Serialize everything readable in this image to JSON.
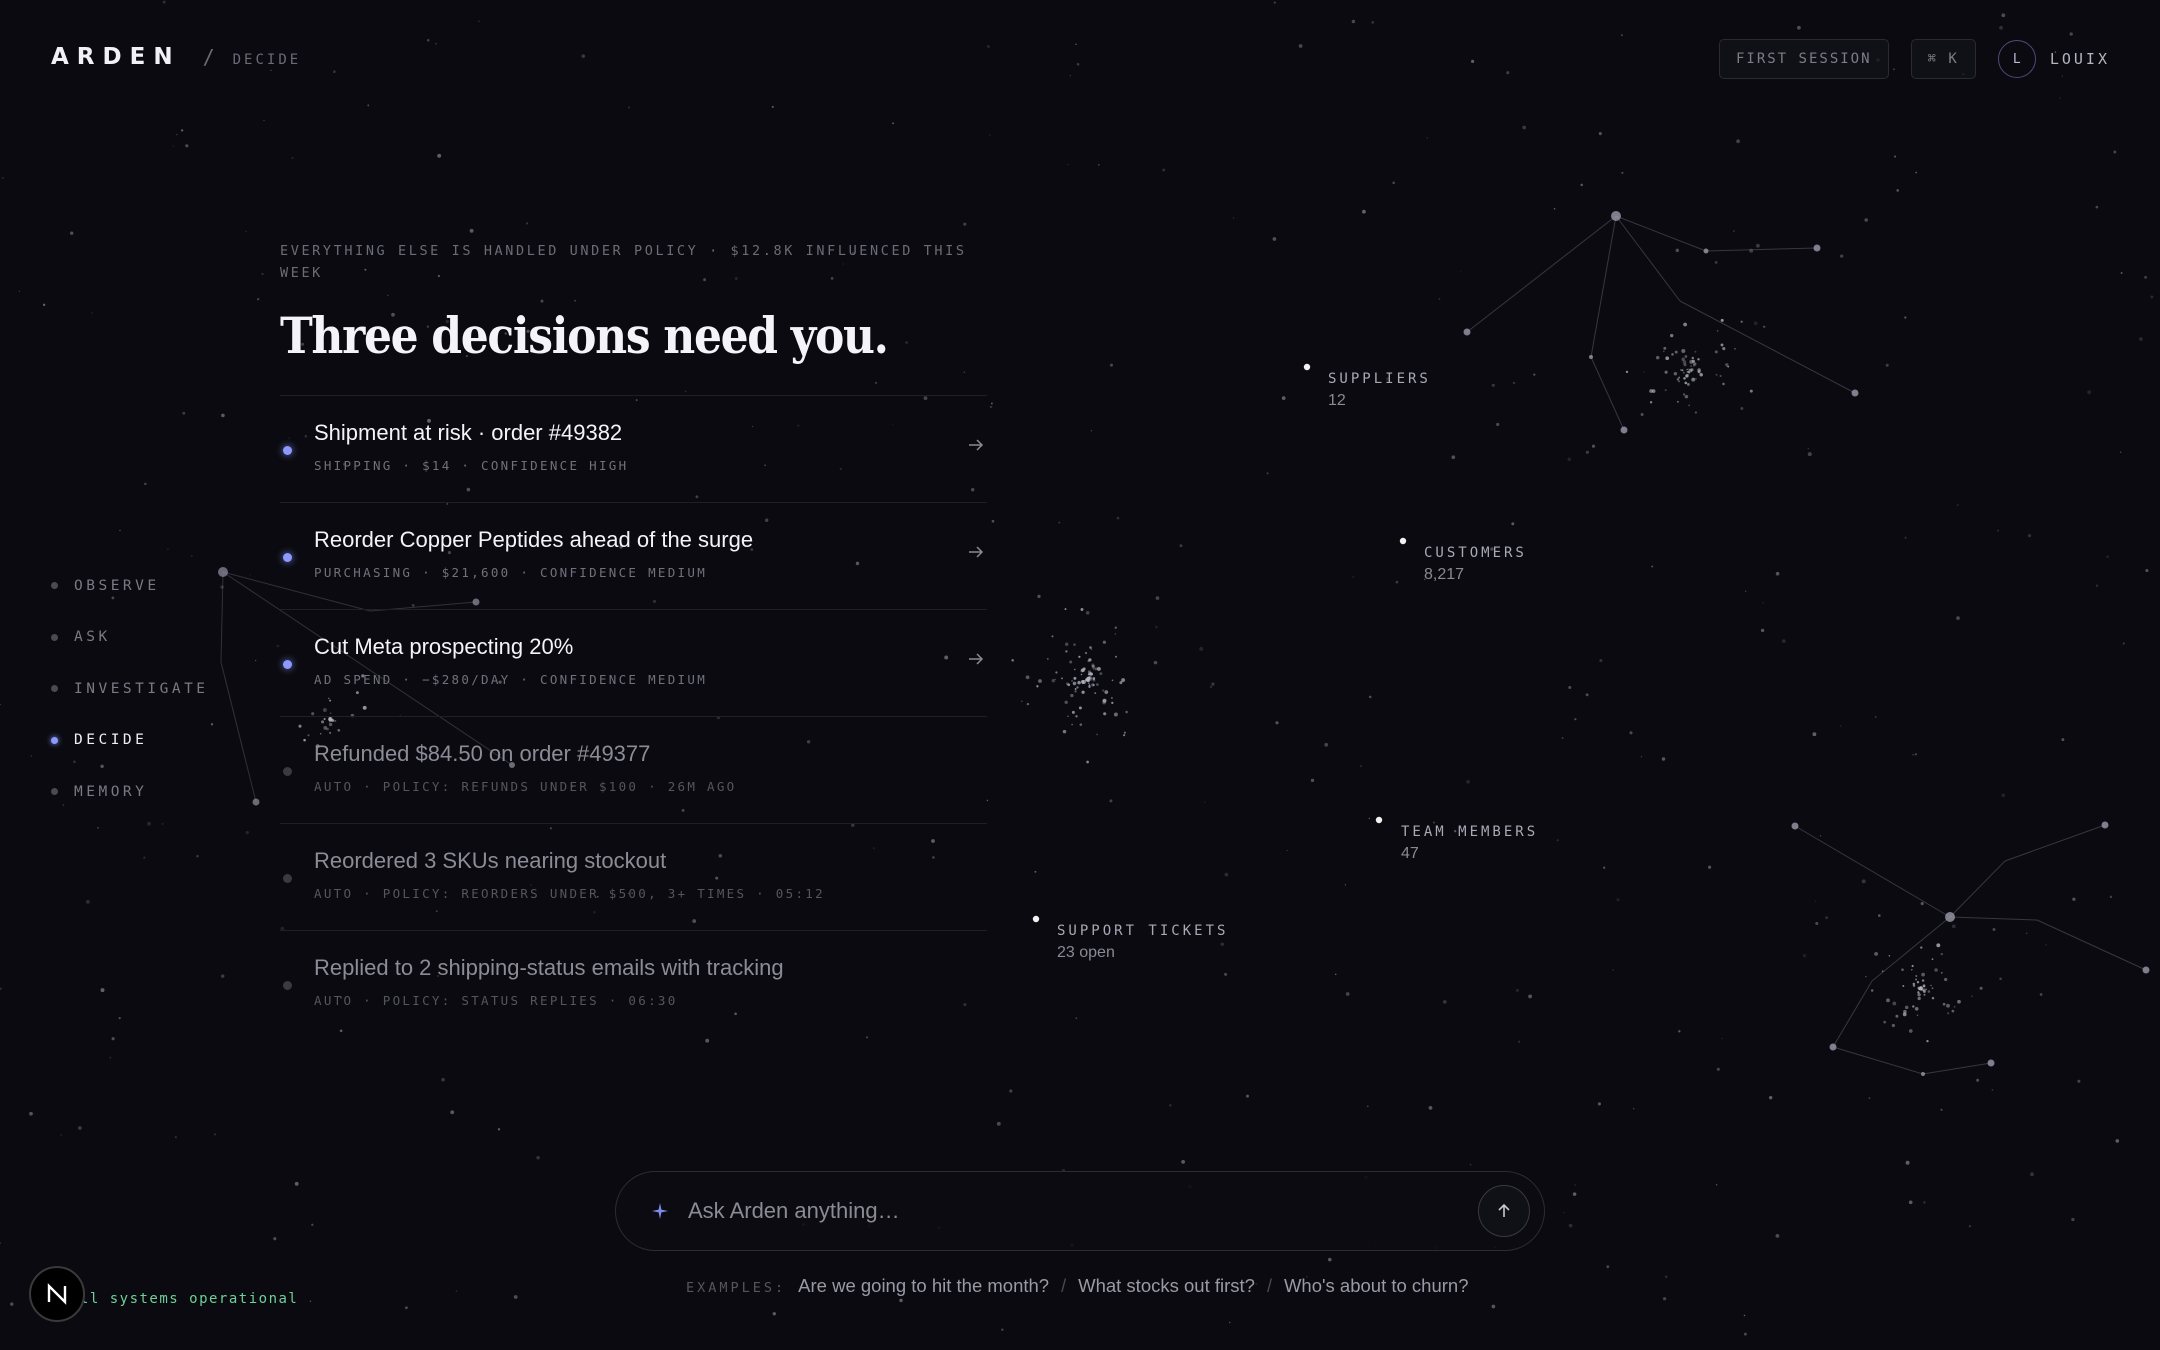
{
  "brand": {
    "name": "ARDEN",
    "separator": "/",
    "section": "DECIDE"
  },
  "header": {
    "first_session": "FIRST SESSION",
    "shortcut": "⌘ K",
    "user_initial": "L",
    "user_name": "LOUIX"
  },
  "nav": {
    "items": [
      {
        "label": "OBSERVE",
        "active": false
      },
      {
        "label": "ASK",
        "active": false
      },
      {
        "label": "INVESTIGATE",
        "active": false
      },
      {
        "label": "DECIDE",
        "active": true
      },
      {
        "label": "MEMORY",
        "active": false
      }
    ]
  },
  "main": {
    "eyebrow": "EVERYTHING ELSE IS HANDLED UNDER POLICY · $12.8K INFLUENCED THIS WEEK",
    "headline": "Three decisions need you.",
    "decisions": [
      {
        "title": "Shipment at risk · order #49382",
        "meta": "SHIPPING · $14 · CONFIDENCE HIGH",
        "pending": true
      },
      {
        "title": "Reorder Copper Peptides ahead of the surge",
        "meta": "PURCHASING · $21,600 · CONFIDENCE MEDIUM",
        "pending": true
      },
      {
        "title": "Cut Meta prospecting 20%",
        "meta": "AD SPEND · −$280/DAY · CONFIDENCE MEDIUM",
        "pending": true
      },
      {
        "title": "Refunded $84.50 on order #49377",
        "meta": "AUTO · POLICY: REFUNDS UNDER $100 · 26M AGO",
        "pending": false
      },
      {
        "title": "Reordered 3 SKUs nearing stockout",
        "meta": "AUTO · POLICY: REORDERS UNDER $500, 3+ TIMES · 05:12",
        "pending": false
      },
      {
        "title": "Replied to 2 shipping-status emails with tracking",
        "meta": "AUTO · POLICY: STATUS REPLIES · 06:30",
        "pending": false
      }
    ]
  },
  "graph": {
    "suppliers": {
      "name": "SUPPLIERS",
      "count": "12"
    },
    "customers": {
      "name": "CUSTOMERS",
      "count": "8,217"
    },
    "team": {
      "name": "TEAM MEMBERS",
      "count": "47"
    },
    "support": {
      "name": "SUPPORT TICKETS",
      "count": "23 open"
    }
  },
  "ask": {
    "placeholder": "Ask Arden anything…",
    "examples_label": "EXAMPLES:",
    "examples": [
      "Are we going to hit the month?",
      "What stocks out first?",
      "Who's about to churn?"
    ]
  },
  "status": {
    "badge": "N",
    "text": "All systems operational"
  },
  "colors": {
    "accent": "#8c9aff",
    "status_ok": "#6fcf97",
    "background": "#0a0a10"
  }
}
